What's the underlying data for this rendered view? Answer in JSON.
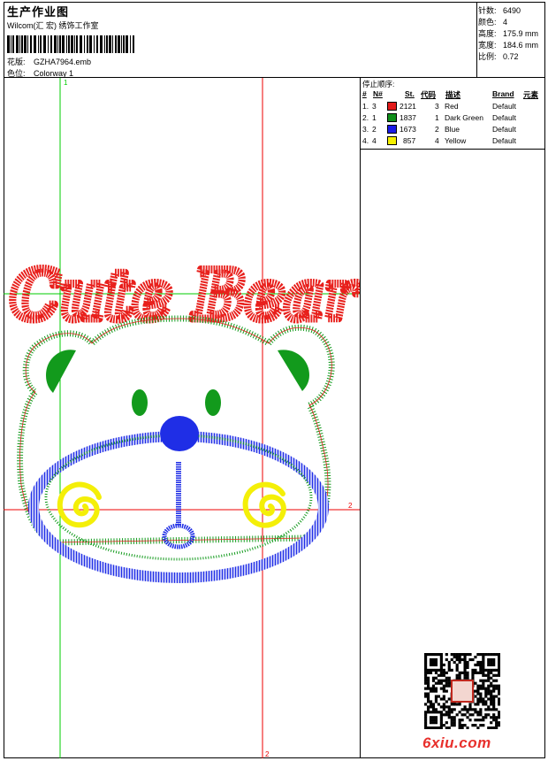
{
  "header": {
    "title": "生产作业图",
    "company": "Wilcom(汇 宏) 绣饰工作室",
    "design_label": "花版:",
    "design_value": "GZHA7964.emb",
    "colorway_label": "色位:",
    "colorway_value": "Colorway 1"
  },
  "stats": [
    {
      "label": "针数:",
      "value": "6490"
    },
    {
      "label": "颜色:",
      "value": "4"
    },
    {
      "label": "高度:",
      "value": "175.9 mm"
    },
    {
      "label": "宽度:",
      "value": "184.6 mm"
    },
    {
      "label": "比例:",
      "value": "0.72"
    }
  ],
  "stop_sequence": {
    "title": "停止顺序:",
    "headers": [
      "#",
      "N#",
      "St.",
      "代码",
      "描述",
      "Brand",
      "元素"
    ],
    "rows": [
      {
        "num": "1.",
        "n": "3",
        "color": "#e11919",
        "st": "2121",
        "code": "3",
        "desc": "Red",
        "brand": "Default"
      },
      {
        "num": "2.",
        "n": "1",
        "color": "#0f8f1a",
        "st": "1837",
        "code": "1",
        "desc": "Dark Green",
        "brand": "Default"
      },
      {
        "num": "3.",
        "n": "2",
        "color": "#1a1ae6",
        "st": "1673",
        "code": "2",
        "desc": "Blue",
        "brand": "Default"
      },
      {
        "num": "4.",
        "n": "4",
        "color": "#f5f000",
        "st": "857",
        "code": "4",
        "desc": "Yellow",
        "brand": "Default"
      }
    ]
  },
  "design": {
    "text": "Cute Bear",
    "thread_red": "#e8201c",
    "thread_green": "#129a1c",
    "thread_blue": "#1f2ee6",
    "thread_yellow": "#f4ef08",
    "guide_green": "#00cc00",
    "guide_red": "#ee0000",
    "guide_label_1": "1",
    "guide_label_2a": "2",
    "guide_label_2b": "2"
  },
  "watermark": {
    "site_prefix": "6",
    "site_rest": "xiu.com"
  }
}
